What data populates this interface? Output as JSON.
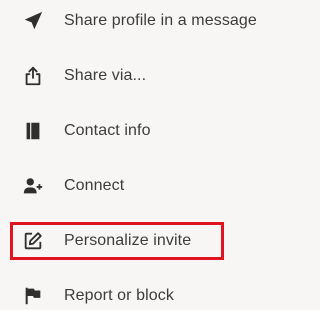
{
  "menu": {
    "items": [
      {
        "label": "Share profile in a message",
        "icon": "send-icon"
      },
      {
        "label": "Share via...",
        "icon": "share-upload-icon"
      },
      {
        "label": "Contact info",
        "icon": "contact-book-icon"
      },
      {
        "label": "Connect",
        "icon": "add-person-icon"
      },
      {
        "label": "Personalize invite",
        "icon": "edit-icon"
      },
      {
        "label": "Report or block",
        "icon": "flag-icon"
      }
    ]
  },
  "highlight": {
    "target": "Personalize invite",
    "color": "#e0141e"
  },
  "colors": {
    "background": "#f7f6f5",
    "text": "#3c3c3c",
    "icon": "#2f2f2f"
  }
}
